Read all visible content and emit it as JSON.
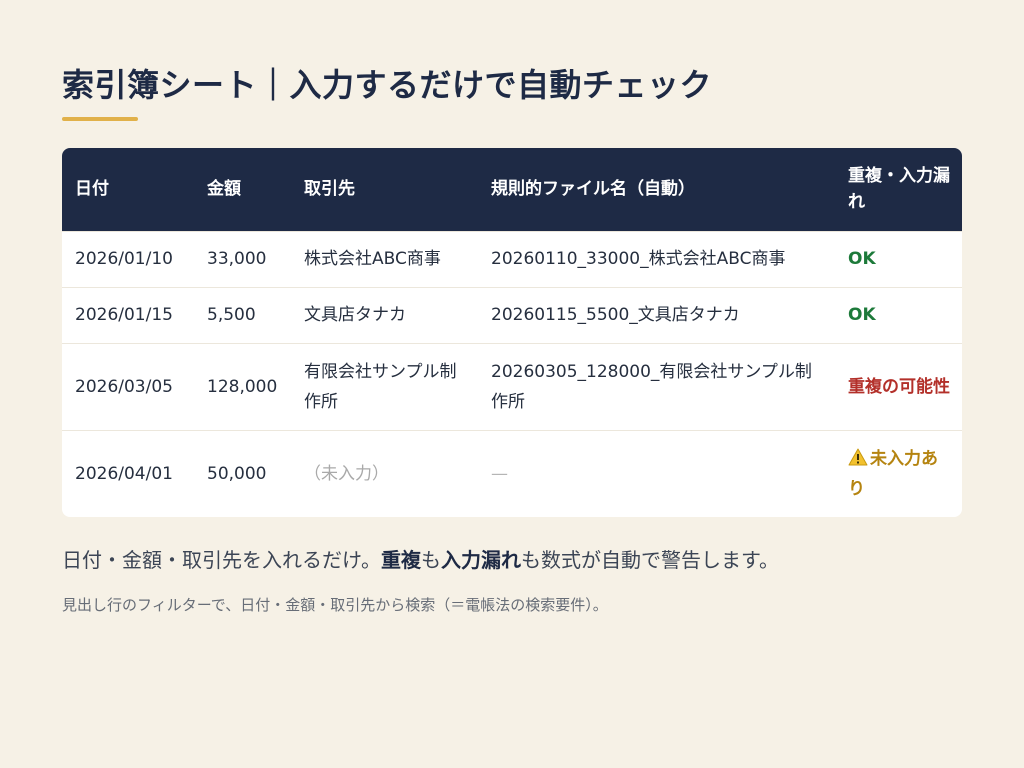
{
  "header": {
    "title": "索引簿シート｜入力するだけで自動チェック"
  },
  "table": {
    "columns": [
      "日付",
      "金額",
      "取引先",
      "規則的ファイル名（自動）",
      "重複・入力漏れ"
    ],
    "rows": [
      {
        "date": "2026/01/10",
        "amount": "33,000",
        "partner": "株式会社ABC商事",
        "filename": "20260110_33000_株式会社ABC商事",
        "status": "OK"
      },
      {
        "date": "2026/01/15",
        "amount": "5,500",
        "partner": "文具店タナカ",
        "filename": "20260115_5500_文具店タナカ",
        "status": "OK"
      },
      {
        "date": "2026/03/05",
        "amount": "128,000",
        "partner": "有限会社サンプル制作所",
        "filename": "20260305_128000_有限会社サンプル制作所",
        "status": "重複の可能性"
      },
      {
        "date": "2026/04/01",
        "amount": "50,000",
        "partner": "（未入力）",
        "filename": "—",
        "status": "未入力あり",
        "status_icon": "warning-icon"
      }
    ]
  },
  "summary": {
    "part1": "日付・金額・取引先を入れるだけ。",
    "bold1": "重複",
    "part2": "も",
    "bold2": "入力漏れ",
    "part3": "も数式が自動で警告します。"
  },
  "note": {
    "text": "見出し行のフィルターで、日付・金額・取引先から検索（＝電帳法の検索要件）。"
  },
  "colors": {
    "background": "#f6f1e6",
    "header_bg": "#1e2a45",
    "accent": "#e1b14a",
    "ok": "#1d7a3a",
    "duplicate": "#b3302a",
    "missing": "#b58410"
  }
}
